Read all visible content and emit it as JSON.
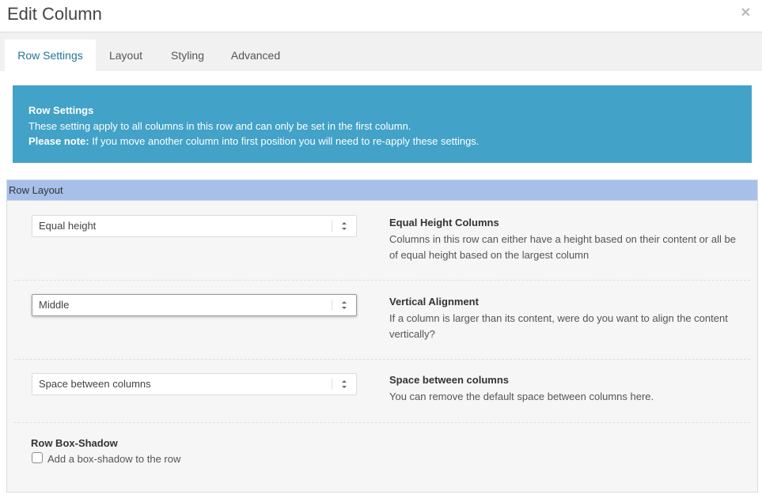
{
  "header": {
    "title": "Edit Column",
    "close_icon": "close-icon"
  },
  "tabs": [
    {
      "label": "Row Settings",
      "active": true
    },
    {
      "label": "Layout",
      "active": false
    },
    {
      "label": "Styling",
      "active": false
    },
    {
      "label": "Advanced",
      "active": false
    }
  ],
  "notice": {
    "title": "Row Settings",
    "line1": "These setting apply to all columns in this row and can only be set in the first column.",
    "note_label": "Please note:",
    "note_text": " If you move another column into first position you will need to re-apply these settings.",
    "background_color": "#42a2c8"
  },
  "panel": {
    "heading": "Row Layout",
    "heading_color": "#a6c0ea",
    "fields": [
      {
        "select_value": "Equal height",
        "title": "Equal Height Columns",
        "description": "Columns in this row can either have a height based on their content or all be of equal height based on the largest column"
      },
      {
        "select_value": "Middle",
        "title": "Vertical Alignment",
        "description": "If a column is larger than its content, were do you want to align the content vertically?"
      },
      {
        "select_value": "Space between columns",
        "title": "Space between columns",
        "description": "You can remove the default space between columns here."
      }
    ],
    "box_shadow": {
      "title": "Row Box-Shadow",
      "checkbox_label": "Add a box-shadow to the row",
      "checked": false
    }
  }
}
